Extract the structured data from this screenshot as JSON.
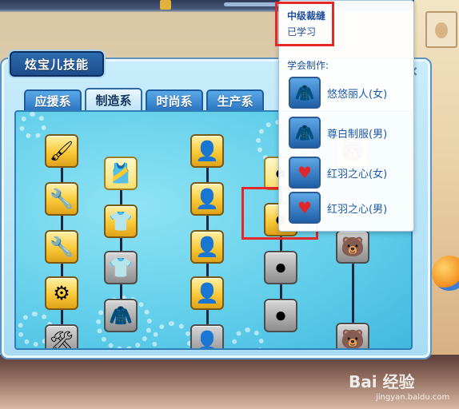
{
  "panel": {
    "title": "炫宝儿技能"
  },
  "tabs": [
    {
      "label": "应援系",
      "active": false
    },
    {
      "label": "制造系",
      "active": true
    },
    {
      "label": "时尚系",
      "active": false
    },
    {
      "label": "生产系",
      "active": false
    }
  ],
  "skill_tree": {
    "columns": [
      {
        "name": "column-1",
        "nodes": [
          {
            "icon": "brush-icon",
            "state": "learned"
          },
          {
            "icon": "wrench-icon",
            "state": "learned"
          },
          {
            "icon": "wrench-icon",
            "state": "learned"
          },
          {
            "icon": "gears-icon",
            "state": "learned"
          },
          {
            "icon": "tools-icon",
            "state": "locked"
          }
        ]
      },
      {
        "name": "column-2",
        "nodes": [
          {
            "icon": "vest-icon",
            "state": "learned"
          },
          {
            "icon": "tshirt-icon",
            "state": "learned"
          },
          {
            "icon": "tshirt-icon",
            "state": "locked"
          },
          {
            "icon": "jacket-icon",
            "state": "locked"
          }
        ]
      },
      {
        "name": "column-3",
        "nodes": [
          {
            "icon": "person-icon",
            "state": "learned"
          },
          {
            "icon": "person-icon",
            "state": "learned"
          },
          {
            "icon": "person-icon",
            "state": "learned"
          },
          {
            "icon": "person-icon",
            "state": "learned"
          },
          {
            "icon": "person-icon",
            "state": "locked"
          }
        ]
      },
      {
        "name": "column-4",
        "nodes": [
          {
            "icon": "button-icon",
            "state": "learned"
          },
          {
            "icon": "button-icon",
            "state": "learned"
          },
          {
            "icon": "button-icon",
            "state": "locked"
          },
          {
            "icon": "button-icon",
            "state": "locked"
          }
        ]
      },
      {
        "name": "column-5",
        "nodes": [
          {
            "icon": "bear-icon",
            "state": "learned"
          },
          {
            "icon": "bear-icon",
            "state": "locked"
          },
          {
            "icon": "bear-icon",
            "state": "locked"
          }
        ]
      }
    ]
  },
  "tooltip": {
    "skill_name": "中级裁缝",
    "status": "已学习",
    "crafts_header": "学会制作:",
    "items": [
      {
        "icon": "jacket-icon",
        "label": "悠悠丽人(女)"
      },
      {
        "icon": "jacket-icon",
        "label": "尊白制服(男)"
      },
      {
        "icon": "heart-icon",
        "label": "红羽之心(女)"
      },
      {
        "icon": "heart-icon",
        "label": "红羽之心(男)"
      }
    ]
  },
  "watermark": {
    "main": "Bai 经验",
    "sub": "jingyan.baidu.com"
  },
  "colors": {
    "highlight": "#e22828",
    "accent": "#2d77c2",
    "gold": "#f8c938"
  }
}
